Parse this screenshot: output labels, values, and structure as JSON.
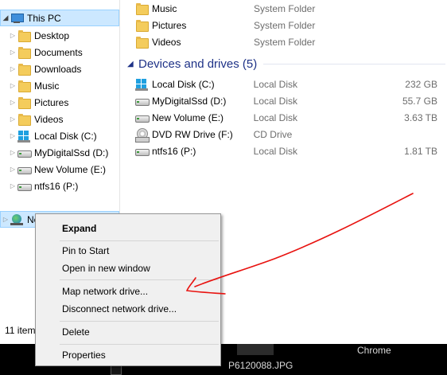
{
  "nav": {
    "items": [
      {
        "label": "This PC",
        "icon": "this-pc-icon"
      },
      {
        "label": "Desktop",
        "icon": "folder-icon"
      },
      {
        "label": "Documents",
        "icon": "folder-icon"
      },
      {
        "label": "Downloads",
        "icon": "folder-icon"
      },
      {
        "label": "Music",
        "icon": "folder-icon"
      },
      {
        "label": "Pictures",
        "icon": "folder-icon"
      },
      {
        "label": "Videos",
        "icon": "folder-icon"
      },
      {
        "label": "Local Disk (C:)",
        "icon": "windows-drive-icon"
      },
      {
        "label": "MyDigitalSsd (D:)",
        "icon": "drive-icon"
      },
      {
        "label": "New Volume (E:)",
        "icon": "drive-icon"
      },
      {
        "label": "ntfs16 (P:)",
        "icon": "drive-icon"
      },
      {
        "label": "Ne",
        "icon": "network-icon"
      }
    ]
  },
  "folders": [
    {
      "name": "Music",
      "type": "System Folder"
    },
    {
      "name": "Pictures",
      "type": "System Folder"
    },
    {
      "name": "Videos",
      "type": "System Folder"
    }
  ],
  "devices_group": {
    "title": "Devices and drives (5)"
  },
  "drives": [
    {
      "name": "Local Disk (C:)",
      "type": "Local Disk",
      "size": "232 GB",
      "icon": "windows-drive-icon"
    },
    {
      "name": "MyDigitalSsd (D:)",
      "type": "Local Disk",
      "size": "55.7 GB",
      "icon": "drive-icon"
    },
    {
      "name": "New Volume (E:)",
      "type": "Local Disk",
      "size": "3.63 TB",
      "icon": "drive-icon"
    },
    {
      "name": "DVD RW Drive (F:)",
      "type": "CD Drive",
      "size": "",
      "icon": "dvd-drive-icon"
    },
    {
      "name": "ntfs16 (P:)",
      "type": "Local Disk",
      "size": "1.81 TB",
      "icon": "drive-icon"
    }
  ],
  "status": {
    "text": "11 item"
  },
  "context_menu": {
    "items": [
      "Expand",
      "Pin to Start",
      "Open in new window",
      "Map network drive...",
      "Disconnect network drive...",
      "Delete",
      "Properties"
    ]
  },
  "taskbar": {
    "chrome_label": "Chrome",
    "photo_label": "P6120088.JPG"
  },
  "colors": {
    "selection": "#cce8ff",
    "group_header": "#1e3287",
    "annotation": "#e8120f"
  }
}
